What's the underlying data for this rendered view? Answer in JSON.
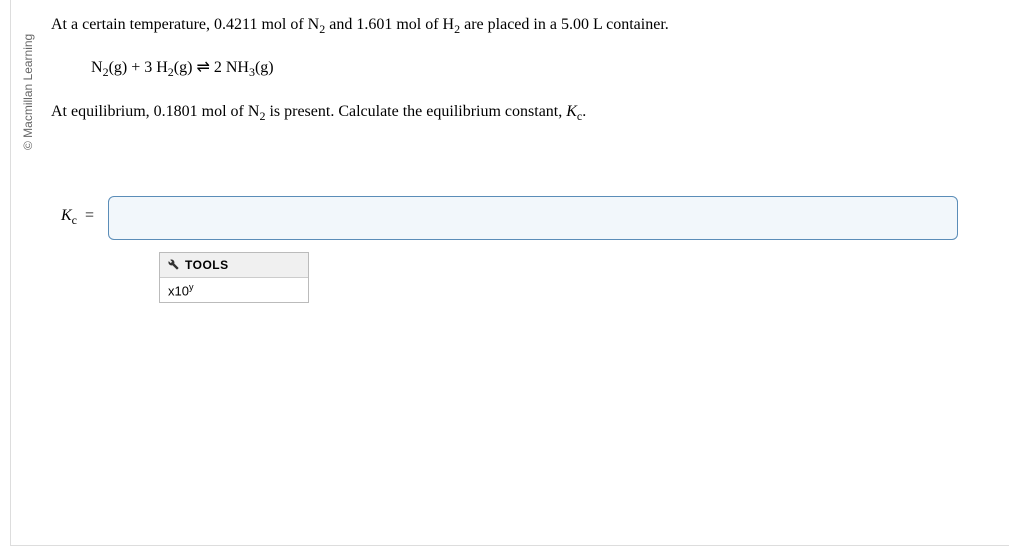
{
  "copyright": "© Macmillan Learning",
  "problem": {
    "line1_pre": "At a certain temperature, ",
    "mol_n2": "0.4211",
    "line1_mid1": " mol of N",
    "line1_mid2": " and ",
    "mol_h2": "1.601",
    "line1_mid3": " mol of H",
    "line1_post": " are placed in a 5.00 L container.",
    "eq_n2": "N",
    "eq_g1": "(g) + 3 H",
    "eq_g2": "(g) ",
    "eq_arrow": "⇌",
    "eq_prod": " 2 NH",
    "eq_g3": "(g)",
    "line2_pre": "At equilibrium, ",
    "mol_n2_eq": "0.1801",
    "line2_mid": " mol of N",
    "line2_post": " is present. Calculate the equilibrium constant, ",
    "kc_var": "K",
    "period": "."
  },
  "answer": {
    "label_K": "K",
    "label_eq": " =",
    "value": "",
    "placeholder": ""
  },
  "tools": {
    "header": "TOOLS",
    "sci": "x10"
  }
}
